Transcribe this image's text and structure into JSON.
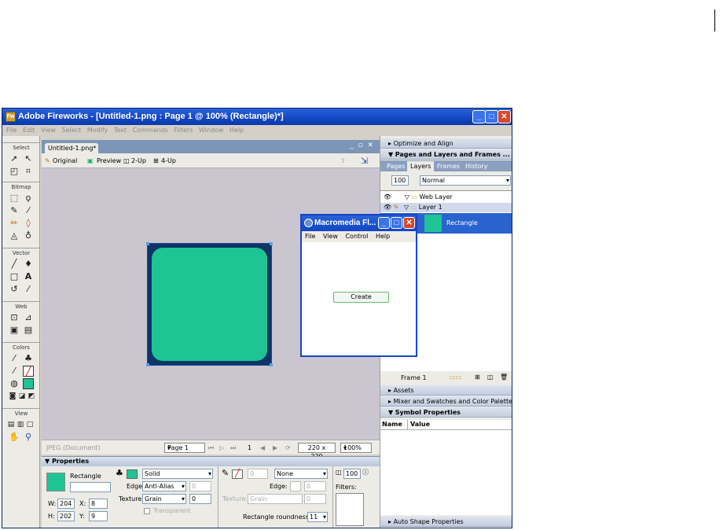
{
  "app": {
    "title": "Adobe Fireworks - [Untitled-1.png : Page 1 @ 100% (Rectangle)*]",
    "menu": [
      "File",
      "Edit",
      "View",
      "Select",
      "Modify",
      "Text",
      "Commands",
      "Filters",
      "Window",
      "Help"
    ]
  },
  "toolbox": {
    "sections": [
      "Select",
      "Bitmap",
      "Vector",
      "Web",
      "Colors",
      "View"
    ]
  },
  "document": {
    "tab": "Untitled-1.png*",
    "views": [
      "Original",
      "Preview",
      "2-Up",
      "4-Up"
    ],
    "status": {
      "format": "JPEG (Document)",
      "page": "Page 1",
      "frame": "1",
      "size": "220 x 220",
      "zoom": "100%"
    },
    "shape_color": "#1fc494",
    "canvas_color": "#0e3568"
  },
  "properties": {
    "header": "Properties",
    "object_name": "Rectangle",
    "fill_type": "Solid",
    "edge_label": "Edge:",
    "edge_value": "Anti-Alias",
    "edge_amount": "0",
    "texture_label": "Texture:",
    "texture_value": "Grain",
    "texture_amount": "0",
    "transparent_label": "Transparent",
    "stroke_size": "0",
    "stroke_type": "None",
    "stroke_edge_label": "Edge:",
    "stroke_edge_amount": "0",
    "stroke_texture_label": "Texture:",
    "stroke_texture_value": "Grain",
    "stroke_texture_amount": "0",
    "roundness_label": "Rectangle roundness:",
    "roundness_value": "11",
    "opacity": "100",
    "filters_label": "Filters:",
    "w_label": "W:",
    "w": "204",
    "h_label": "H:",
    "h": "202",
    "x_label": "X:",
    "x": "8",
    "y_label": "Y:",
    "y": "9"
  },
  "panels": {
    "optimize": "Optimize and Align",
    "pages_layers": "Pages and Layers and Frames ...",
    "tabs": [
      "Pages",
      "Layers",
      "Frames",
      "History"
    ],
    "opacity": "100",
    "blend": "Normal",
    "layers": [
      "Web Layer",
      "Layer 1"
    ],
    "object": "Rectangle",
    "frame": "Frame 1",
    "assets": "Assets",
    "mixer": "Mixer and Swatches and Color Palette",
    "symbol": "Symbol Properties",
    "col_name": "Name",
    "col_value": "Value",
    "autoshape": "Auto Shape Properties"
  },
  "flash_window": {
    "title": "Macromedia Fl...",
    "menu": [
      "File",
      "View",
      "Control",
      "Help"
    ],
    "button": "Create"
  }
}
